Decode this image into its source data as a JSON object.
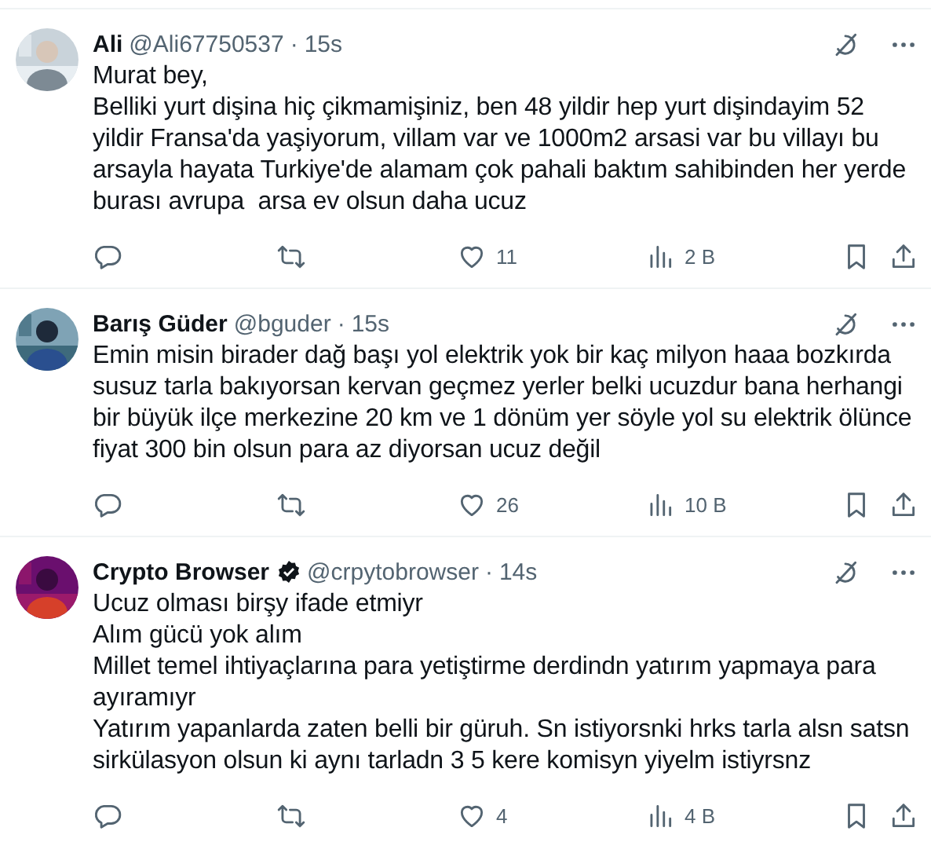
{
  "tweets": [
    {
      "name": "Ali",
      "verified": false,
      "handle": "@Ali67750537",
      "separator": "·",
      "time": "15s",
      "text": "Murat bey,\nBelliki yurt dişina hiç çikmamişiniz, ben 48 yildir hep yurt dişindayim 52 yildir Fransa'da yaşiyorum, villam var ve 1000m2 arsasi var bu villayı bu arsayla hayata Turkiye'de alamam çok pahali baktım sahibinden her yerde burası avrupa  arsa ev olsun daha ucuz",
      "likes": "11",
      "views": "2 B"
    },
    {
      "name": "Barış Güder",
      "verified": false,
      "handle": "@bguder",
      "separator": "·",
      "time": "15s",
      "text": "Emin misin birader dağ başı yol elektrik yok bir kaç milyon haaa bozkırda susuz tarla bakıyorsan kervan geçmez yerler belki ucuzdur bana herhangi bir büyük ilçe merkezine 20 km ve 1 dönüm yer söyle yol su elektrik ölünce fiyat 300 bin olsun para az diyorsan ucuz değil",
      "likes": "26",
      "views": "10 B"
    },
    {
      "name": "Crypto Browser",
      "verified": true,
      "handle": "@crpytobrowser",
      "separator": "·",
      "time": "14s",
      "text": "Ucuz olması birşy ifade etmiyr\nAlım gücü yok alım\nMillet temel ihtiyaçlarına para yetiştirme derdindn yatırım yapmaya para ayıramıyr\nYatırım yapanlarda zaten belli bir güruh. Sn istiyorsnki hrks tarla alsn satsn sirkülasyon olsun ki aynı tarladn 3 5 kere komisyn yiyelm istiyrsnz",
      "likes": "4",
      "views": "4 B"
    }
  ]
}
